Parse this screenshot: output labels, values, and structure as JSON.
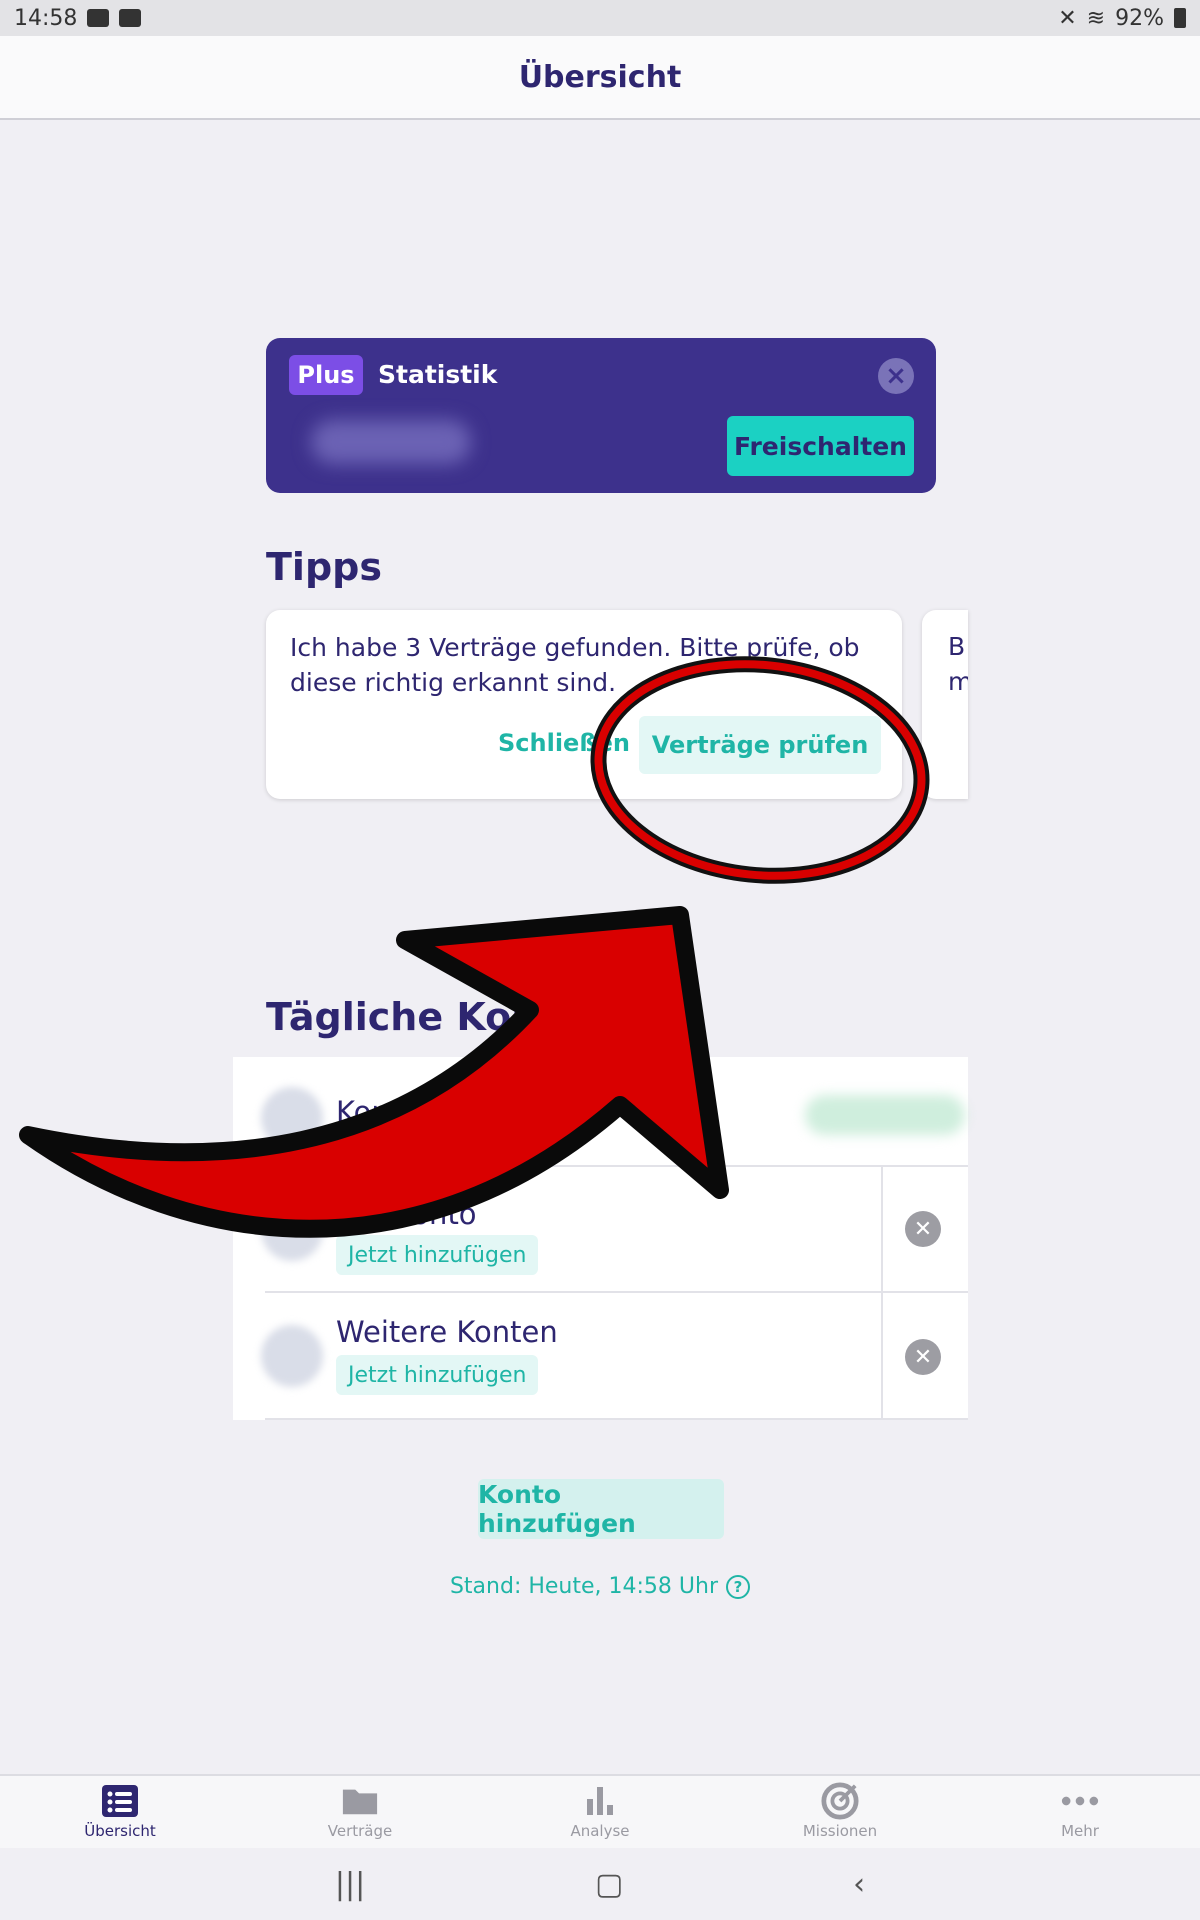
{
  "status_bar": {
    "time": "14:58",
    "battery": "92%"
  },
  "header": {
    "title": "Übersicht"
  },
  "plus_card": {
    "badge": "Plus",
    "title": "Statistik",
    "unlock_label": "Freischalten",
    "blurred_value": "0000 €"
  },
  "tips": {
    "section_title": "Tipps",
    "card": {
      "text": "Ich habe 3 Verträge gefunden. Bitte prüfe, ob diese richtig erkannt sind.",
      "close_label": "Schließen",
      "action_label": "Verträge prüfen"
    },
    "next_card_lines": [
      "B",
      "m"
    ]
  },
  "accounts": {
    "section_title": "Tägliche Konten",
    "rows": [
      {
        "name": "Konto"
      },
      {
        "name": "Girokonto",
        "add_label": "Jetzt hinzufügen"
      },
      {
        "name": "Weitere Konten",
        "add_label": "Jetzt hinzufügen"
      }
    ],
    "add_account_label": "Konto hinzufügen",
    "stand_text": "Stand: Heute, 14:58 Uhr"
  },
  "tabbar": {
    "items": [
      {
        "label": "Übersicht",
        "icon": "list-icon",
        "active": true
      },
      {
        "label": "Verträge",
        "icon": "folder-icon",
        "active": false
      },
      {
        "label": "Analyse",
        "icon": "bar-chart-icon",
        "active": false
      },
      {
        "label": "Missionen",
        "icon": "target-icon",
        "active": false
      },
      {
        "label": "Mehr",
        "icon": "more-dots-icon",
        "active": false
      }
    ]
  },
  "colors": {
    "primary": "#3d318c",
    "accent": "#1bd1c3",
    "text": "#2e2670",
    "annotation_red": "#d90000"
  }
}
